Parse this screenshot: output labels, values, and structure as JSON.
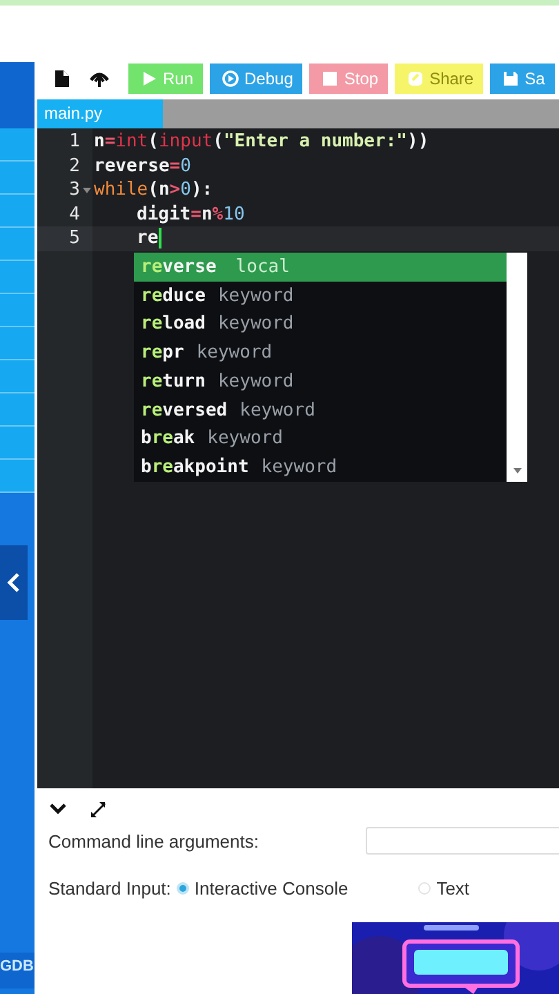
{
  "toolbar": {
    "buttons": [
      {
        "kind": "run",
        "label": "Run"
      },
      {
        "kind": "debug",
        "label": "Debug"
      },
      {
        "kind": "stop",
        "label": "Stop"
      },
      {
        "kind": "share",
        "label": "Share"
      },
      {
        "kind": "save",
        "label": "Sa"
      }
    ]
  },
  "tabs": [
    {
      "label": "main.py",
      "selected": true
    }
  ],
  "editor": {
    "lines": [
      {
        "number": "1",
        "foldable": false,
        "active": false,
        "indented": false,
        "tokens": [
          {
            "kind": "name",
            "text": "n"
          },
          {
            "kind": "op",
            "text": "="
          },
          {
            "kind": "builtin",
            "text": "int"
          },
          {
            "kind": "plain",
            "text": "("
          },
          {
            "kind": "builtin",
            "text": "input"
          },
          {
            "kind": "plain",
            "text": "("
          },
          {
            "kind": "string",
            "text": "\"Enter a number:\""
          },
          {
            "kind": "plain",
            "text": "))"
          }
        ]
      },
      {
        "number": "2",
        "foldable": false,
        "active": false,
        "indented": false,
        "tokens": [
          {
            "kind": "name",
            "text": "reverse"
          },
          {
            "kind": "op",
            "text": "="
          },
          {
            "kind": "number",
            "text": "0"
          }
        ]
      },
      {
        "number": "3",
        "foldable": true,
        "active": false,
        "indented": false,
        "tokens": [
          {
            "kind": "keyword",
            "text": "while"
          },
          {
            "kind": "plain",
            "text": "(n"
          },
          {
            "kind": "op",
            "text": ">"
          },
          {
            "kind": "number",
            "text": "0"
          },
          {
            "kind": "plain",
            "text": "):"
          }
        ]
      },
      {
        "number": "4",
        "foldable": false,
        "active": false,
        "indented": true,
        "tokens": [
          {
            "kind": "name",
            "text": "digit"
          },
          {
            "kind": "op",
            "text": "="
          },
          {
            "kind": "name",
            "text": "n"
          },
          {
            "kind": "op",
            "text": "%"
          },
          {
            "kind": "number",
            "text": "10"
          }
        ]
      },
      {
        "number": "5",
        "foldable": false,
        "active": true,
        "indented": true,
        "tokens": [
          {
            "kind": "name",
            "text": "re"
          }
        ]
      }
    ],
    "autocomplete": [
      {
        "selected": true,
        "type": "local",
        "parts": [
          {
            "text": "re",
            "match": true
          },
          {
            "text": "verse",
            "match": false
          }
        ]
      },
      {
        "selected": false,
        "type": "keyword",
        "parts": [
          {
            "text": "re",
            "match": true
          },
          {
            "text": "duce",
            "match": false
          }
        ]
      },
      {
        "selected": false,
        "type": "keyword",
        "parts": [
          {
            "text": "re",
            "match": true
          },
          {
            "text": "load",
            "match": false
          }
        ]
      },
      {
        "selected": false,
        "type": "keyword",
        "parts": [
          {
            "text": "re",
            "match": true
          },
          {
            "text": "pr",
            "match": false
          }
        ]
      },
      {
        "selected": false,
        "type": "keyword",
        "parts": [
          {
            "text": "re",
            "match": true
          },
          {
            "text": "turn",
            "match": false
          }
        ]
      },
      {
        "selected": false,
        "type": "keyword",
        "parts": [
          {
            "text": "re",
            "match": true
          },
          {
            "text": "versed",
            "match": false
          }
        ]
      },
      {
        "selected": false,
        "type": "keyword",
        "parts": [
          {
            "text": "b",
            "match": false
          },
          {
            "text": "re",
            "match": true
          },
          {
            "text": "ak",
            "match": false
          }
        ]
      },
      {
        "selected": false,
        "type": "keyword",
        "parts": [
          {
            "text": "b",
            "match": false
          },
          {
            "text": "re",
            "match": true
          },
          {
            "text": "akpoint",
            "match": false
          }
        ]
      }
    ]
  },
  "sidebar": {
    "item_count_rows": [
      {
        "selected": false
      },
      {
        "selected": false
      },
      {
        "selected": false
      },
      {
        "selected": false
      },
      {
        "selected": false
      },
      {
        "selected": false
      },
      {
        "selected": false
      },
      {
        "selected": false
      },
      {
        "selected": false
      },
      {
        "selected": false
      },
      {
        "selected": false
      }
    ],
    "footer": "GDB"
  },
  "bottom_panel": {
    "arguments_label": "Command line arguments:",
    "stdin_label": "Standard Input:",
    "stdin_options": [
      {
        "label": "Interactive Console",
        "selected": true
      },
      {
        "label": "Text",
        "selected": false
      }
    ]
  }
}
